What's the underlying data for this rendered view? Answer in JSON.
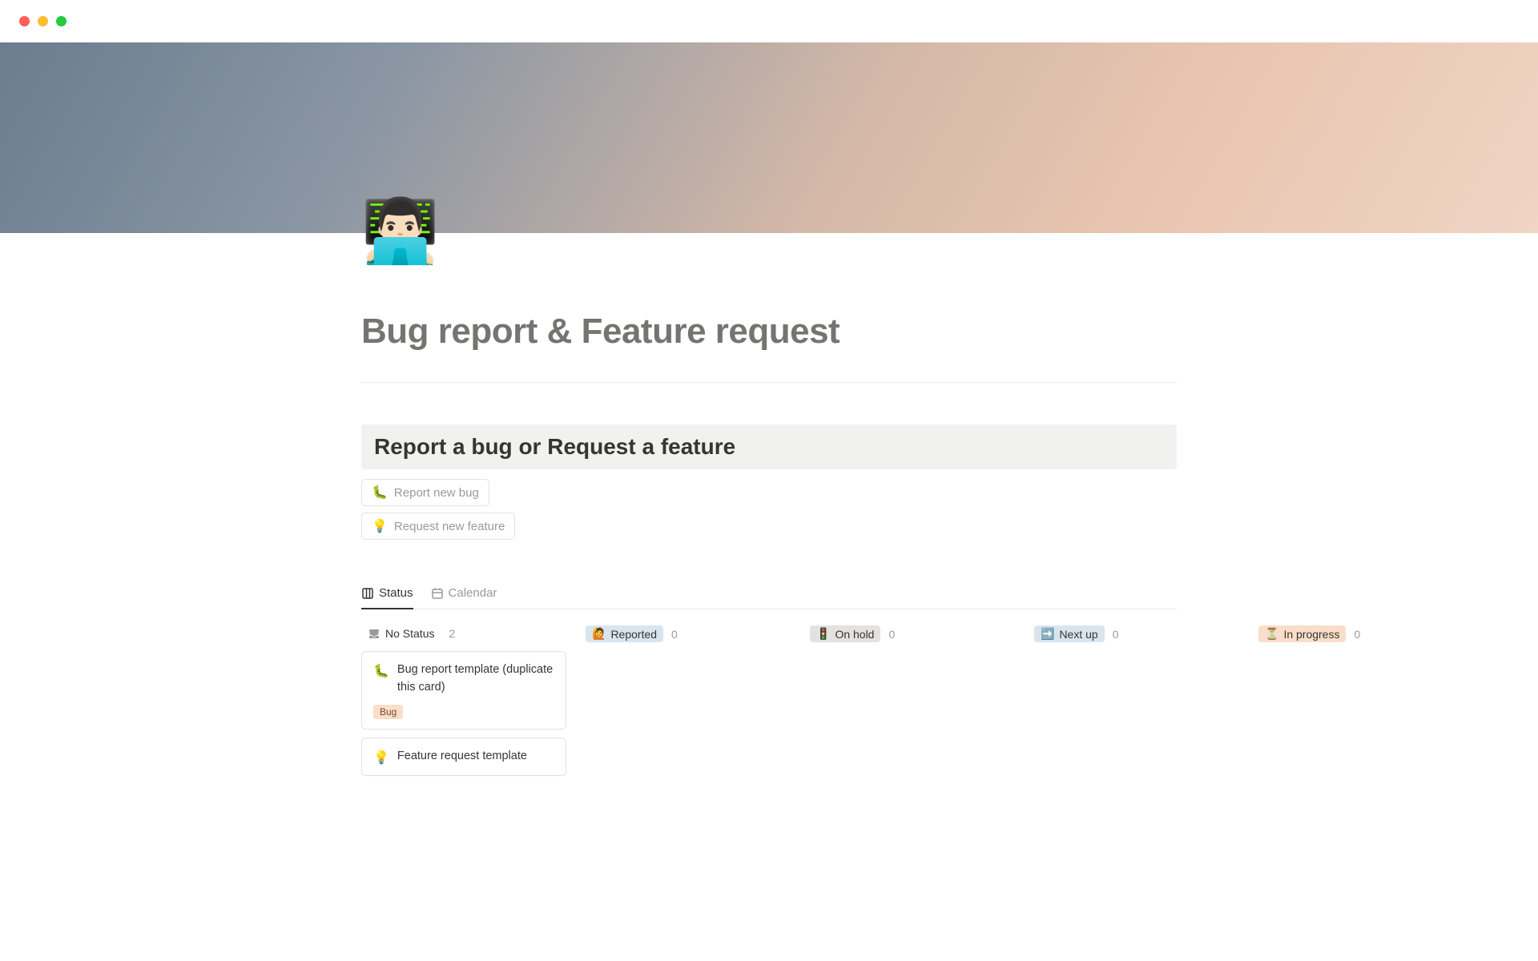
{
  "page": {
    "icon": "👨🏻‍💻",
    "title": "Bug report & Feature request"
  },
  "callout": {
    "heading": "Report a bug or Request a feature"
  },
  "buttons": [
    {
      "icon": "🐛",
      "label": "Report new bug"
    },
    {
      "icon": "💡",
      "label": "Request new feature"
    }
  ],
  "tabs": [
    {
      "id": "status",
      "label": "Status",
      "active": true
    },
    {
      "id": "calendar",
      "label": "Calendar",
      "active": false
    }
  ],
  "columns": [
    {
      "key": "none",
      "label": "No Status",
      "count": "2"
    },
    {
      "key": "reported",
      "icon": "🙋",
      "label": "Reported",
      "count": "0"
    },
    {
      "key": "hold",
      "icon": "🚦",
      "label": "On hold",
      "count": "0"
    },
    {
      "key": "next",
      "icon": "➡️",
      "label": "Next up",
      "count": "0"
    },
    {
      "key": "progress",
      "icon": "⏳",
      "label": "In progress",
      "count": "0"
    }
  ],
  "cards_none": [
    {
      "icon": "🐛",
      "title": "Bug report template (duplicate this card)",
      "tag": "Bug"
    },
    {
      "icon": "💡",
      "title": "Feature request template"
    }
  ]
}
